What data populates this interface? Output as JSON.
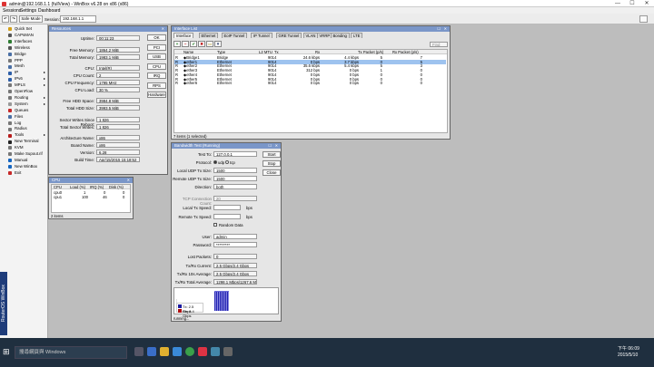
{
  "titlebar": {
    "title": "admin@192.168.1.1 (fullView) - WinBox v6.28 on x86 (x86)",
    "min": "—",
    "max": "☐",
    "close": "✕"
  },
  "menu": [
    "Sessions",
    "Settings",
    "Dashboard"
  ],
  "toolbar": {
    "undo": "↶",
    "redo": "↷",
    "safe_mode": "Safe Mode",
    "session_label": "Session:",
    "session_value": "192.168.1.1"
  },
  "sidebar": {
    "brand": "RouterOS WinBox",
    "items": [
      {
        "label": "Quick Set",
        "color": "#d4a017",
        "sub": false
      },
      {
        "label": "CAPsMAN",
        "color": "#555",
        "sub": false
      },
      {
        "label": "Interfaces",
        "color": "#2e7d32",
        "sub": false
      },
      {
        "label": "Wireless",
        "color": "#555",
        "sub": false
      },
      {
        "label": "Bridge",
        "color": "#4a6fa5",
        "sub": false
      },
      {
        "label": "PPP",
        "color": "#777",
        "sub": false
      },
      {
        "label": "Mesh",
        "color": "#4a6fa5",
        "sub": false
      },
      {
        "label": "IP",
        "color": "#2e5fa8",
        "sub": true
      },
      {
        "label": "IPv6",
        "color": "#2e5fa8",
        "sub": true
      },
      {
        "label": "MPLS",
        "color": "#777",
        "sub": true
      },
      {
        "label": "OpenFlow",
        "color": "#777",
        "sub": false
      },
      {
        "label": "Routing",
        "color": "#777",
        "sub": true
      },
      {
        "label": "System",
        "color": "#999",
        "sub": true
      },
      {
        "label": "Queues",
        "color": "#c62828",
        "sub": false
      },
      {
        "label": "Files",
        "color": "#4a6fa5",
        "sub": false
      },
      {
        "label": "Log",
        "color": "#777",
        "sub": false
      },
      {
        "label": "Radius",
        "color": "#777",
        "sub": false
      },
      {
        "label": "Tools",
        "color": "#b71c1c",
        "sub": true
      },
      {
        "label": "New Terminal",
        "color": "#222",
        "sub": false
      },
      {
        "label": "KVM",
        "color": "#777",
        "sub": false
      },
      {
        "label": "Make Supout.rif",
        "color": "#777",
        "sub": false
      },
      {
        "label": "Manual",
        "color": "#1565c0",
        "sub": false
      },
      {
        "label": "New WinBox",
        "color": "#1565c0",
        "sub": false
      },
      {
        "label": "Exit",
        "color": "#c62828",
        "sub": false
      }
    ]
  },
  "resources": {
    "title": "Resources",
    "fields": [
      {
        "label": "Uptime:",
        "value": "00:11:23"
      },
      {
        "label": "Free Memory:",
        "value": "1864.2 MiB"
      },
      {
        "label": "Total Memory:",
        "value": "1983.1 MiB"
      },
      {
        "label": "CPU:",
        "value": "Intel(R)"
      },
      {
        "label": "CPU Count:",
        "value": "2"
      },
      {
        "label": "CPU Frequency:",
        "value": "1795 MHz"
      },
      {
        "label": "CPU Load:",
        "value": "30 %"
      },
      {
        "label": "Free HDD Space:",
        "value": "3984.8 MiB"
      },
      {
        "label": "Total HDD Size:",
        "value": "3993.5 MiB"
      },
      {
        "label": "Sector Writes Since Reboot:",
        "value": "1 826"
      },
      {
        "label": "Total Sector Writes:",
        "value": "1 826"
      },
      {
        "label": "Architecture Name:",
        "value": "x86"
      },
      {
        "label": "Board Name:",
        "value": "x86"
      },
      {
        "label": "Version:",
        "value": "6.28"
      },
      {
        "label": "Build Time:",
        "value": "Apr/15/2015 15:18:52"
      }
    ],
    "buttons": [
      "OK",
      "PCI",
      "USB",
      "CPU",
      "IRQ",
      "RPS",
      "Hardware"
    ]
  },
  "cpu": {
    "title": "CPU",
    "headers": [
      "CPU",
      "Load (%)",
      "IRQ (%)",
      "Disk (%)"
    ],
    "rows": [
      [
        "cpu0",
        "1",
        "0",
        "0"
      ],
      [
        "cpu1",
        "100",
        "46",
        "0"
      ]
    ],
    "status": "2 items"
  },
  "interfaces": {
    "title": "Interface List",
    "tabs": [
      "Interface",
      "Ethernet",
      "EoIP Tunnel",
      "IP Tunnel",
      "GRE Tunnel",
      "VLAN",
      "VRRP",
      "Bonding",
      "LTE"
    ],
    "find": "Find",
    "headers": [
      "Name",
      "Type",
      "L2 MTU",
      "Tx",
      "Rx",
      "Tx Packet (p/s)",
      "Rx Packet (p/s)"
    ],
    "rows": [
      {
        "flag": "R",
        "name": "◆Bridge1",
        "type": "Bridge",
        "mtu": "9014",
        "tx": "24.6 kbps",
        "rx": "4.4 kbps",
        "txp": "5",
        "rxp": "7"
      },
      {
        "flag": "R",
        "name": "◆ether1",
        "type": "Ethernet",
        "mtu": "9014",
        "tx": "0 bps",
        "rx": "3.7 kbps",
        "txp": "0",
        "rxp": "5"
      },
      {
        "flag": "R",
        "name": "◆ether2",
        "type": "Ethernet",
        "mtu": "9014",
        "tx": "35.6 kbps",
        "rx": "5.4 kbps",
        "txp": "5",
        "rxp": "3"
      },
      {
        "flag": "R",
        "name": "◆ether3",
        "type": "Ethernet",
        "mtu": "9014",
        "tx": "312 bps",
        "rx": "0 bps",
        "txp": "1",
        "rxp": "0"
      },
      {
        "flag": "R",
        "name": "◆ether4",
        "type": "Ethernet",
        "mtu": "9014",
        "tx": "0 bps",
        "rx": "0 bps",
        "txp": "0",
        "rxp": "0"
      },
      {
        "flag": "R",
        "name": "◆ether5",
        "type": "Ethernet",
        "mtu": "9014",
        "tx": "0 bps",
        "rx": "0 bps",
        "txp": "0",
        "rxp": "0"
      },
      {
        "flag": "R",
        "name": "◆ether6",
        "type": "Ethernet",
        "mtu": "9014",
        "tx": "0 bps",
        "rx": "0 bps",
        "txp": "0",
        "rxp": "0"
      }
    ],
    "status": "7 items (1 selected)"
  },
  "btest": {
    "title": "Bandwidth Test (Running)",
    "test_to_label": "Test To:",
    "test_to": "127.0.0.1",
    "protocol_label": "Protocol:",
    "udp": "udp",
    "tcp": "tcp",
    "local_udp_label": "Local UDP Tx Size:",
    "local_udp": "1500",
    "remote_udp_label": "Remote UDP Tx Size:",
    "remote_udp": "1500",
    "direction_label": "Direction:",
    "direction": "both",
    "tcp_conn_label": "TCP Connection Count:",
    "tcp_conn": "20",
    "local_speed_label": "Local Tx Speed:",
    "local_unit": "bps",
    "remote_speed_label": "Remote Tx Speed:",
    "remote_unit": "bps",
    "random_label": "Random Data",
    "user_label": "User:",
    "user": "admin",
    "password_label": "Password:",
    "password": "*********",
    "lost_label": "Lost Packets:",
    "lost": "0",
    "tx_current_label": "Tx/Rx Current:",
    "tx_current": "2.5 Gbps/2.4 Gbps",
    "tx_avg10_label": "Tx/Rx 10s Average:",
    "tx_avg10": "2.5 Gbps/2.4 Gbps",
    "tx_total_label": "Tx/Rx Total Average:",
    "tx_total": "1298.1 Mbps/1267.6 M...",
    "legend_tx": "Tx: 2.5 Gbps",
    "legend_rx": "Rx: 2.4 Gbps",
    "buttons": [
      "Start",
      "Stop",
      "Close"
    ],
    "status": "running...",
    "colors": {
      "tx": "#1a1aa0",
      "rx": "#b01010"
    }
  },
  "taskbar": {
    "search": "搜尋網頁與 Windows",
    "time": "下午 06:09",
    "date": "2015/5/10"
  }
}
